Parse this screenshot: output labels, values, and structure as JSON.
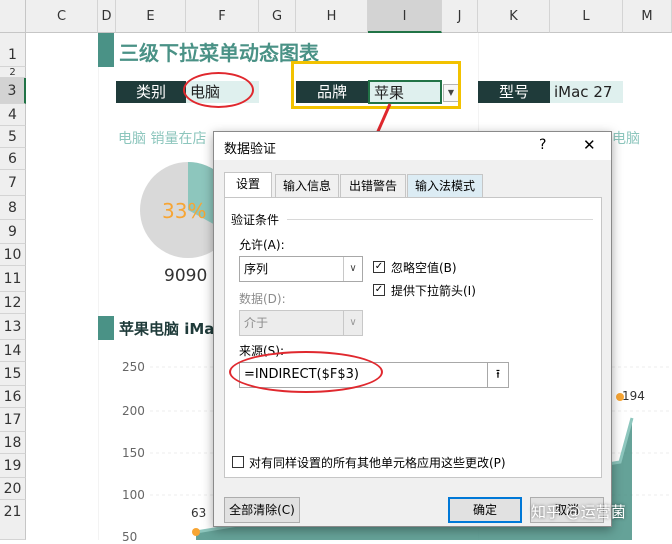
{
  "sheet": {
    "columns": [
      "C",
      "D",
      "E",
      "F",
      "G",
      "H",
      "I",
      "J",
      "K",
      "L",
      "M"
    ],
    "selected_column": "I",
    "rows": [
      "1",
      "2",
      "3",
      "4",
      "5",
      "6",
      "7",
      "8",
      "9",
      "10",
      "11",
      "12",
      "13",
      "14",
      "15",
      "16",
      "17",
      "18",
      "19",
      "20",
      "21"
    ],
    "selected_row": "3",
    "title": "三级下拉菜单动态图表",
    "category_label": "类别",
    "category_value": "电脑",
    "brand_label": "品牌",
    "brand_value": "苹果",
    "model_label": "型号",
    "model_value": "iMac 27",
    "pie_caption_left": "电脑 销量在店",
    "pie_caption_right": "电脑",
    "pie_percent": "33%",
    "pie_fraction": 0.33,
    "pie_number": "9090",
    "section_title": "苹果电脑 iMa",
    "chart_y_ticks": [
      "250",
      "200",
      "150",
      "100",
      "50"
    ],
    "chart_label_left": "63",
    "chart_label_right": "194"
  },
  "dialog": {
    "title": "数据验证",
    "help": "?",
    "close": "✕",
    "tabs": [
      "设置",
      "输入信息",
      "出错警告",
      "输入法模式"
    ],
    "validation_group": "验证条件",
    "allow_label": "允许(A):",
    "allow_value": "序列",
    "data_label": "数据(D):",
    "data_value": "介于",
    "ignore_blank": "忽略空值(B)",
    "dropdown_arrow": "提供下拉箭头(I)",
    "source_label": "来源(S):",
    "source_value": "=INDIRECT($F$3)",
    "apply_all": "对有同样设置的所有其他单元格应用这些更改(P)",
    "clear_all": "全部清除(C)",
    "ok": "确定",
    "cancel": "取消"
  },
  "watermark": "知乎 @运营菌",
  "colors": {
    "teal": "#4a9286",
    "dark_label": "#1f3b3a",
    "highlight_red": "#e0282e",
    "highlight_yellow": "#f2c200",
    "pie_orange": "#f7a534"
  }
}
